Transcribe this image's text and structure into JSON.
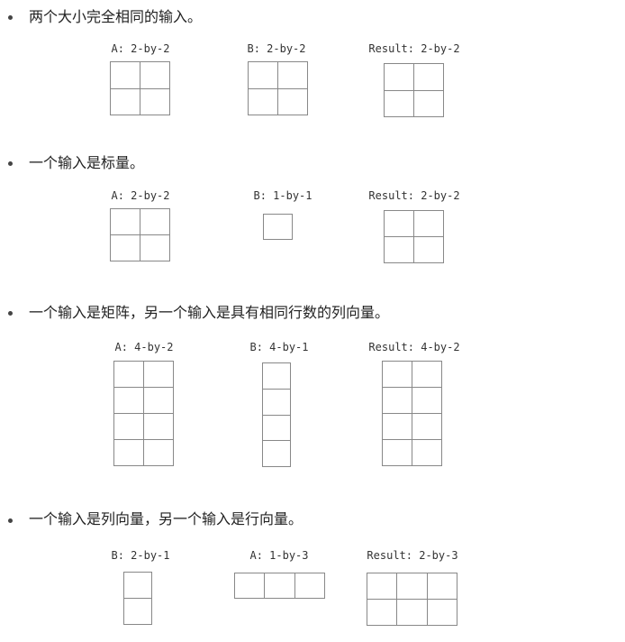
{
  "sections": [
    {
      "text": "两个大小完全相同的输入。",
      "diagrams": [
        {
          "label": "A: 2-by-2",
          "rows": 2,
          "cols": 2
        },
        {
          "label": "B: 2-by-2",
          "rows": 2,
          "cols": 2
        },
        {
          "label": "Result: 2-by-2",
          "rows": 2,
          "cols": 2
        }
      ]
    },
    {
      "text": "一个输入是标量。",
      "diagrams": [
        {
          "label": "A: 2-by-2",
          "rows": 2,
          "cols": 2
        },
        {
          "label": "B: 1-by-1",
          "rows": 1,
          "cols": 1
        },
        {
          "label": "Result: 2-by-2",
          "rows": 2,
          "cols": 2
        }
      ]
    },
    {
      "text": "一个输入是矩阵，另一个输入是具有相同行数的列向量。",
      "diagrams": [
        {
          "label": "A: 4-by-2",
          "rows": 4,
          "cols": 2
        },
        {
          "label": "B: 4-by-1",
          "rows": 4,
          "cols": 1
        },
        {
          "label": "Result: 4-by-2",
          "rows": 4,
          "cols": 2
        }
      ]
    },
    {
      "text": "一个输入是列向量，另一个输入是行向量。",
      "diagrams": [
        {
          "label": "B: 2-by-1",
          "rows": 2,
          "cols": 1
        },
        {
          "label": "A: 1-by-3",
          "rows": 1,
          "cols": 3
        },
        {
          "label": "Result: 2-by-3",
          "rows": 2,
          "cols": 3
        }
      ]
    }
  ]
}
